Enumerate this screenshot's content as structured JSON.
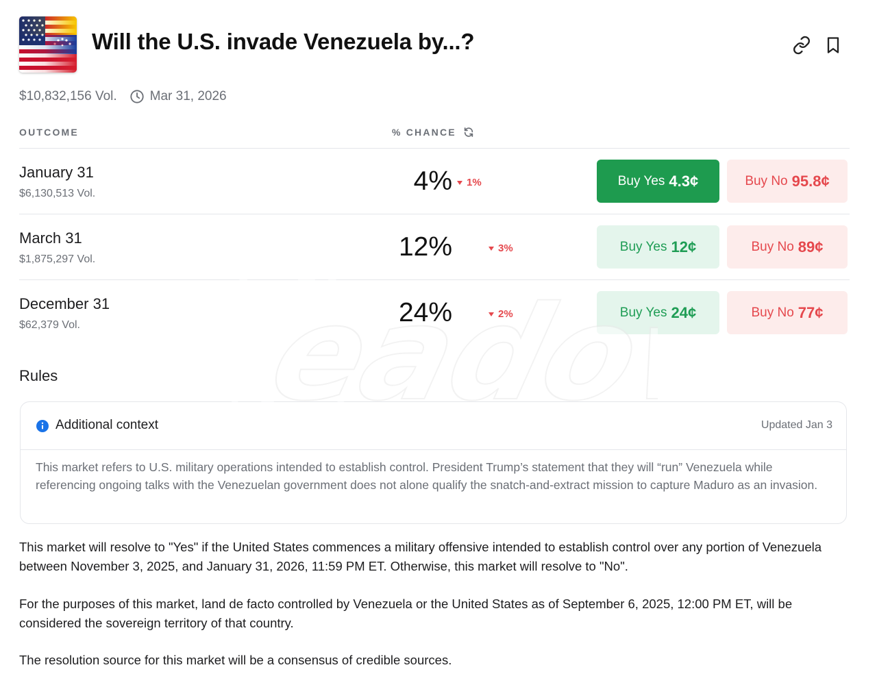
{
  "header": {
    "title": "Will the U.S. invade Venezuela by...?",
    "flag_icon": "us-venezuela-flag-icon",
    "link_icon": "link-icon",
    "bookmark_icon": "bookmark-icon"
  },
  "meta": {
    "volume": "$10,832,156 Vol.",
    "end_date": "Mar 31, 2026",
    "clock_icon": "clock-icon"
  },
  "columns": {
    "outcome": "OUTCOME",
    "chance": "% CHANCE",
    "refresh_icon": "refresh-icon"
  },
  "outcomes": [
    {
      "name": "January 31",
      "volume": "$6,130,513 Vol.",
      "chance": "4%",
      "delta": "1%",
      "yes_label": "Buy Yes",
      "yes_price": "4.3¢",
      "no_label": "Buy No",
      "no_price": "95.8¢"
    },
    {
      "name": "March 31",
      "volume": "$1,875,297 Vol.",
      "chance": "12%",
      "delta": "3%",
      "yes_label": "Buy Yes",
      "yes_price": "12¢",
      "no_label": "Buy No",
      "no_price": "89¢"
    },
    {
      "name": "December 31",
      "volume": "$62,379 Vol.",
      "chance": "24%",
      "delta": "2%",
      "yes_label": "Buy Yes",
      "yes_price": "24¢",
      "no_label": "Buy No",
      "no_price": "77¢"
    }
  ],
  "rules": {
    "title": "Rules",
    "context": {
      "title": "Additional context",
      "updated": "Updated Jan 3",
      "body": "This market refers to U.S. military operations intended to establish control. President Trump’s statement that they will “run” Venezuela while referencing ongoing talks with the Venezuelan government does not alone qualify the snatch-and-extract mission to capture Maduro as an invasion."
    },
    "paragraphs": [
      "This market will resolve to \"Yes\" if the United States commences a military offensive intended to establish control over any portion of Venezuela between November 3, 2025, and January 31, 2026, 11:59 PM ET. Otherwise, this market will resolve to \"No\".",
      "For the purposes of this market, land de facto controlled by Venezuela or the United States as of September 6, 2025, 12:00 PM ET, will be considered the sovereign territory of that country.",
      "The resolution source for this market will be a consensus of credible sources."
    ]
  },
  "watermark": {
    "text": "Readovka"
  },
  "colors": {
    "yes_green": "#1e9b4f",
    "yes_bg": "#e4f5ec",
    "no_red": "#e5484d",
    "no_bg": "#fdeceb",
    "muted": "#6b6f76",
    "info_blue": "#1a73e8"
  }
}
